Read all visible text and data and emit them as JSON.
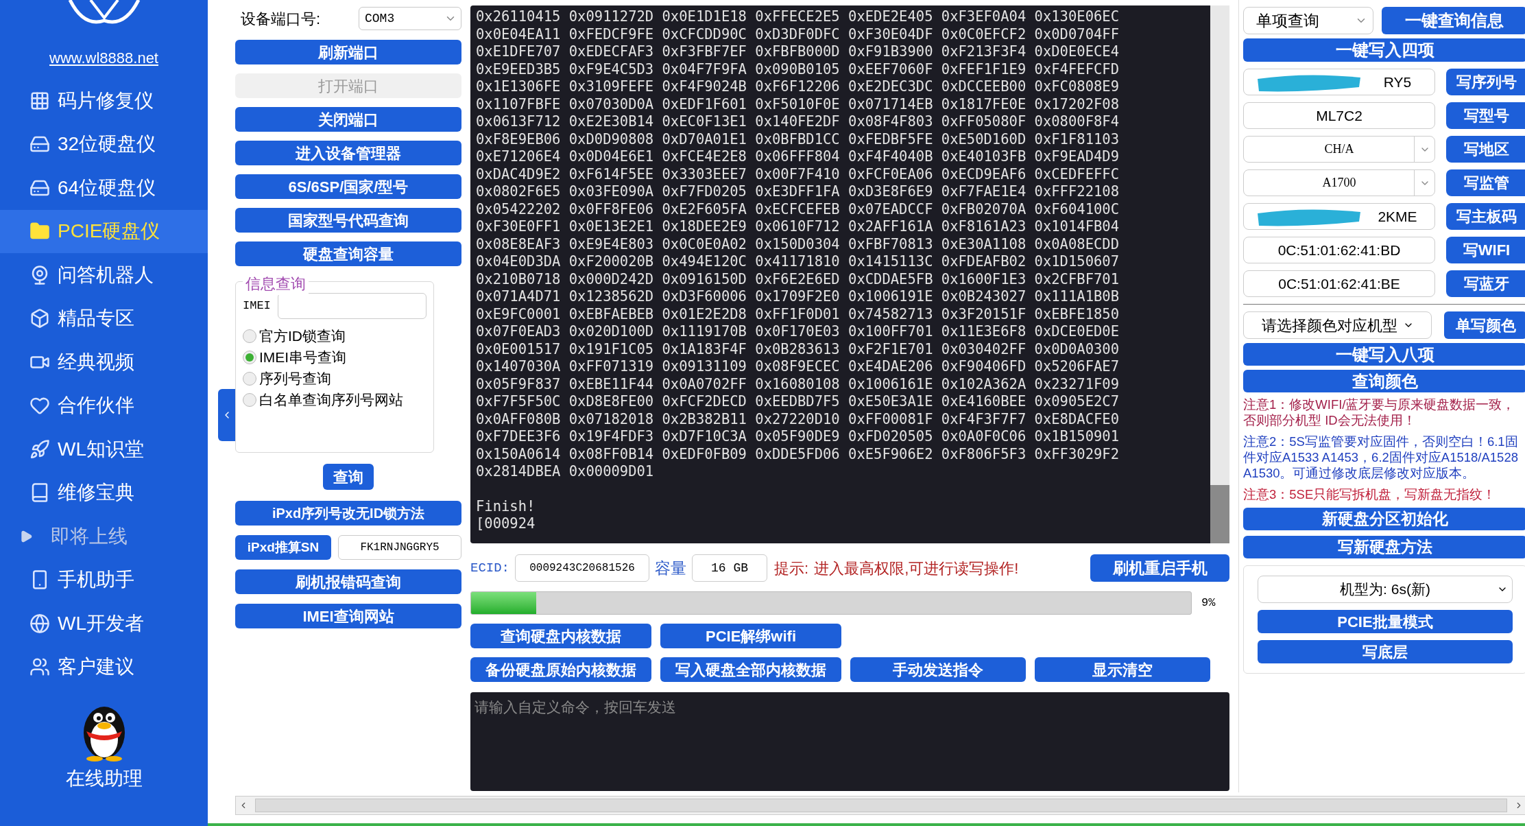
{
  "sidebar": {
    "site_link": "www.wl8888.net",
    "items": [
      {
        "label": "码片修复仪",
        "selected": false,
        "kind": "item"
      },
      {
        "label": "32位硬盘仪",
        "selected": false,
        "kind": "item"
      },
      {
        "label": "64位硬盘仪",
        "selected": false,
        "kind": "item"
      },
      {
        "label": "PCIE硬盘仪",
        "selected": true,
        "kind": "item"
      },
      {
        "label": "问答机器人",
        "selected": false,
        "kind": "item"
      },
      {
        "label": "精品专区",
        "selected": false,
        "kind": "item"
      },
      {
        "label": "经典视频",
        "selected": false,
        "kind": "item"
      },
      {
        "label": "合作伙伴",
        "selected": false,
        "kind": "item"
      },
      {
        "label": "WL知识堂",
        "selected": false,
        "kind": "item"
      },
      {
        "label": "维修宝典",
        "selected": false,
        "kind": "item"
      },
      {
        "label": "即将上线",
        "selected": false,
        "kind": "upcoming"
      },
      {
        "label": "手机助手",
        "selected": false,
        "kind": "item"
      },
      {
        "label": "WL开发者",
        "selected": false,
        "kind": "item"
      },
      {
        "label": "客户建议",
        "selected": false,
        "kind": "item"
      }
    ],
    "help_label": "在线助理"
  },
  "left_panel": {
    "port_label": "设备端口号:",
    "port_value": "COM3",
    "buttons": [
      {
        "label": "刷新端口",
        "disabled": false
      },
      {
        "label": "打开端口",
        "disabled": true
      },
      {
        "label": "关闭端口",
        "disabled": false
      },
      {
        "label": "进入设备管理器",
        "disabled": false
      },
      {
        "label": "6S/6SP/国家/型号",
        "disabled": false
      },
      {
        "label": "国家型号代码查询",
        "disabled": false
      },
      {
        "label": "硬盘查询容量",
        "disabled": false
      }
    ],
    "info_query": {
      "title": "信息查询",
      "imei_label": "IMEI",
      "options": [
        {
          "label": "官方ID锁查询",
          "selected": false
        },
        {
          "label": "IMEI串号查询",
          "selected": true
        },
        {
          "label": "序列号查询",
          "selected": false
        },
        {
          "label": "白名单查询序列号网站",
          "selected": false
        }
      ],
      "query_button": "查询"
    },
    "method_button": "iPxd序列号改无ID锁方法",
    "sn_button": "iPxd推算SN",
    "sn_value": "FK1RNJNGGRY5",
    "bottom_buttons": [
      "刷机报错码查询",
      "IMEI查询网站"
    ]
  },
  "console": {
    "lines": [
      "0x26110415 0x0911272D 0x0E1D1E18 0xFFECE2E5 0xEDE2E405 0xF3EF0A04 0x130E06EC",
      "0x0E04EA11 0xFEDCF9FE 0xCFCDD90C 0xD3DF0DFC 0xF30E04DF 0x0C0EFCF2 0x0D0704FF",
      "0xE1DFE707 0xEDECFAF3 0xF3FBF7EF 0xFBFB000D 0xF91B3900 0xF213F3F4 0xD0E0ECE4",
      "0xE9EED3B5 0xF9E4C5D3 0x04F7F9FA 0x090B0105 0xEEF7060F 0xFEF1F1E9 0xF4FEFCFD",
      "0x1E1306FE 0x3109FEFE 0xF4F9024B 0xF6F12206 0xE2DEC3DC 0xDCCEEB00 0xFC0808E9",
      "0x1107FBFE 0x07030D0A 0xEDF1F601 0xF5010F0E 0x071714EB 0x1817FE0E 0x17202F08",
      "0x0613F712 0xE2E30B14 0xEC0F13E1 0x140FE2DF 0x08F4F803 0xFF05080F 0x0800F8F4",
      "0xF8E9EB06 0xD0D90808 0xD70A01E1 0x0BFBD1CC 0xFEDBF5FE 0xE50D160D 0xF1F81103",
      "0xE71206E4 0x0D04E6E1 0xFCE4E2E8 0x06FFF804 0xF4F4040B 0xE40103FB 0xF9EAD4D9",
      "0xDAC4D9E2 0xF614F5EE 0x3303EEE7 0x00F7F410 0xFCF0EA06 0xECD9EAF6 0xCEDFEFFC",
      "0x0802F6E5 0x03FE090A 0xF7FD0205 0xE3DFF1FA 0xD3E8F6E9 0xF7FAE1E4 0xFFF22108",
      "0x05422202 0x0FF8FE06 0xE2F605FA 0xECFCEFEB 0x07EADCCF 0xFB02070A 0xF604100C",
      "0xF30E0FF1 0x0E13E2E1 0x18DEE2E9 0x0610F712 0x2AFF161A 0xF8161A23 0x1014FB04",
      "0x08E8EAF3 0xE9E4E803 0x0C0E0A02 0x150D0304 0xFBF70813 0xE30A1108 0x0A08ECDD",
      "0x04E0D3DA 0xF200020B 0x494E120C 0x41171810 0x1415113C 0xFDEAFB02 0x1D150607",
      "0x210B0718 0x000D242D 0x0916150D 0xF6E2E6ED 0xCDDAE5FB 0x1600F1E3 0x2CFBF701",
      "0x071A4D71 0x1238562D 0xD3F60006 0x1709F2E0 0x1006191E 0x0B243027 0x111A1B0B",
      "0xE9FC0001 0xEBFAEBEB 0x01E2E2D8 0xFF1F0D01 0x74582713 0x3F20151F 0xEBFE1850",
      "0x07F0EAD3 0x020D100D 0x1119170B 0x0F170E03 0x100FF701 0x11E3E6F8 0xDCE0ED0E",
      "0x0E001517 0x191F1C05 0x1A183F4F 0x0B283613 0xF2F1E701 0x030402FF 0x0D0A0300",
      "0x1407030A 0xFF071319 0x09131109 0x08F9ECEC 0xE4DAE206 0xF90406FD 0x5206FAE7",
      "0x05F9F837 0xEBE11F44 0x0A0702FF 0x16080108 0x1006161E 0x102A362A 0x23271F09",
      "0xF7F5F50C 0xD8E8FE00 0xFCF2DECD 0xEEDBD7F5 0xE50E3A1E 0xE4160BEE 0x0905E2C7",
      "0x0AFF080B 0x07182018 0x2B382B11 0x27220D10 0xFF00081F 0xF4F3F7F7 0xE8DACFE0",
      "0xF7DEE3F6 0x19F4FDF3 0xD7F10C3A 0x05F90DE9 0xFD020505 0x0A0F0C06 0x1B150901",
      "0x150A0614 0x08FF0B14 0xEDF0FB09 0xDDE5FD06 0xE5F906E2 0xF806F5F3 0xFF3029F2",
      "0x2814DBEA 0x00009D01"
    ],
    "status_lines": [
      "Finish!",
      "[000924"
    ]
  },
  "device_row": {
    "ecid_label": "ECID:",
    "ecid": "0009243C20681526",
    "capacity_label": "容量",
    "capacity": "16 GB",
    "hint_label": "提示:",
    "hint": "进入最高权限,可进行读写操作!",
    "reboot_button": "刷机重启手机"
  },
  "progress": {
    "level": 0.09,
    "reading": "9%"
  },
  "actions": [
    [
      "查询硬盘内核数据",
      "PCIE解绑wifi"
    ],
    [
      "备份硬盘原始内核数据",
      "写入硬盘全部内核数据",
      "手动发送指令",
      "显示清空"
    ]
  ],
  "command": {
    "placeholder": "请输入自定义命令，按回车发送"
  },
  "right_panel": {
    "query_mode": "单项查询",
    "query_button": "一键查询信息",
    "write_four_button": "一键写入四项",
    "fields": [
      {
        "kind": "input",
        "value": "RY5",
        "redacted": true,
        "button": "写序列号"
      },
      {
        "kind": "input",
        "value": "ML7C2",
        "redacted": false,
        "button": "写型号"
      },
      {
        "kind": "select",
        "value": "CH/A",
        "redacted": false,
        "button": "写地区"
      },
      {
        "kind": "select",
        "value": "A1700",
        "redacted": false,
        "button": "写监管"
      },
      {
        "kind": "input",
        "value": "2KME",
        "redacted": true,
        "button": "写主板码"
      },
      {
        "kind": "input",
        "value": "0C:51:01:62:41:BD",
        "redacted": false,
        "button": "写WIFI"
      },
      {
        "kind": "input",
        "value": "0C:51:01:62:41:BE",
        "redacted": false,
        "button": "写蓝牙"
      }
    ],
    "color_placeholder": "请选择颜色对应机型",
    "color_button": "单写颜色",
    "write_eight_button": "一键写入八项",
    "query_color_button": "查询颜色",
    "notes": [
      {
        "text": "注意1：修改WIFI/蓝牙要与原来硬盘数据一致，否则部分机型 ID会无法使用！",
        "color": "#a3204a"
      },
      {
        "text": "注意2：5S写监管要对应固件，否则空白！6.1固件对应A1533 A1453，6.2固件对应A1518/A1528 A1530。可通过修改底层修改对应版本。",
        "color": "#1f3fbf"
      },
      {
        "text": "注意3：5SE只能写拆机盘，写新盘无指纹！",
        "color": "#c0203a"
      }
    ],
    "disk_buttons": [
      "新硬盘分区初始化",
      "写新硬盘方法"
    ],
    "model_value": "机型为: 6s(新)",
    "bottom_buttons": [
      "PCIE批量模式",
      "写底层"
    ]
  }
}
